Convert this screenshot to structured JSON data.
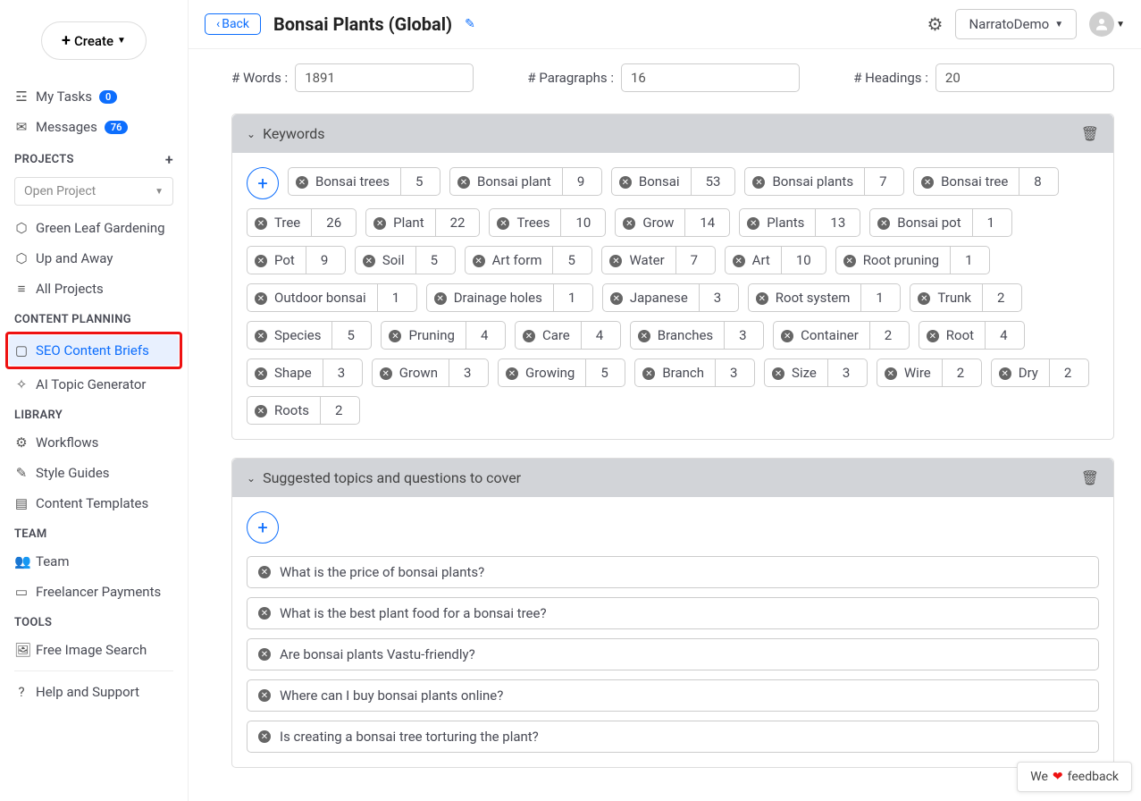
{
  "sidebar": {
    "create": "Create",
    "my_tasks": "My Tasks",
    "my_tasks_badge": "0",
    "messages": "Messages",
    "messages_badge": "76",
    "projects_head": "PROJECTS",
    "open_project": "Open Project",
    "projects": [
      "Green Leaf Gardening",
      "Up and Away",
      "All Projects"
    ],
    "content_planning_head": "CONTENT PLANNING",
    "seo_briefs": "SEO Content Briefs",
    "ai_topic": "AI Topic Generator",
    "library_head": "LIBRARY",
    "workflows": "Workflows",
    "style_guides": "Style Guides",
    "templates": "Content Templates",
    "team_head": "TEAM",
    "team": "Team",
    "freelancer": "Freelancer Payments",
    "tools_head": "TOOLS",
    "image_search": "Free Image Search",
    "help": "Help and Support"
  },
  "header": {
    "back": "Back",
    "title": "Bonsai Plants (Global)",
    "dropdown": "NarratoDemo"
  },
  "stats": {
    "words_label": "# Words :",
    "words": "1891",
    "paras_label": "# Paragraphs :",
    "paras": "16",
    "heads_label": "# Headings :",
    "heads": "20"
  },
  "keywords_title": "Keywords",
  "keywords": [
    {
      "label": "Bonsai trees",
      "count": "5"
    },
    {
      "label": "Bonsai plant",
      "count": "9"
    },
    {
      "label": "Bonsai",
      "count": "53"
    },
    {
      "label": "Bonsai plants",
      "count": "7"
    },
    {
      "label": "Bonsai tree",
      "count": "8"
    },
    {
      "label": "Tree",
      "count": "26"
    },
    {
      "label": "Plant",
      "count": "22"
    },
    {
      "label": "Trees",
      "count": "10"
    },
    {
      "label": "Grow",
      "count": "14"
    },
    {
      "label": "Plants",
      "count": "13"
    },
    {
      "label": "Bonsai pot",
      "count": "1"
    },
    {
      "label": "Pot",
      "count": "9"
    },
    {
      "label": "Soil",
      "count": "5"
    },
    {
      "label": "Art form",
      "count": "5"
    },
    {
      "label": "Water",
      "count": "7"
    },
    {
      "label": "Art",
      "count": "10"
    },
    {
      "label": "Root pruning",
      "count": "1"
    },
    {
      "label": "Outdoor bonsai",
      "count": "1"
    },
    {
      "label": "Drainage holes",
      "count": "1"
    },
    {
      "label": "Japanese",
      "count": "3"
    },
    {
      "label": "Root system",
      "count": "1"
    },
    {
      "label": "Trunk",
      "count": "2"
    },
    {
      "label": "Species",
      "count": "5"
    },
    {
      "label": "Pruning",
      "count": "4"
    },
    {
      "label": "Care",
      "count": "4"
    },
    {
      "label": "Branches",
      "count": "3"
    },
    {
      "label": "Container",
      "count": "2"
    },
    {
      "label": "Root",
      "count": "4"
    },
    {
      "label": "Shape",
      "count": "3"
    },
    {
      "label": "Grown",
      "count": "3"
    },
    {
      "label": "Growing",
      "count": "5"
    },
    {
      "label": "Branch",
      "count": "3"
    },
    {
      "label": "Size",
      "count": "3"
    },
    {
      "label": "Wire",
      "count": "2"
    },
    {
      "label": "Dry",
      "count": "2"
    },
    {
      "label": "Roots",
      "count": "2"
    }
  ],
  "topics_title": "Suggested topics and questions to cover",
  "topics": [
    "What is the price of bonsai plants?",
    "What is the best plant food for a bonsai tree?",
    "Are bonsai plants Vastu-friendly?",
    "Where can I buy bonsai plants online?",
    "Is creating a bonsai tree torturing the plant?"
  ],
  "feedback": {
    "pre": "We",
    "post": "feedback"
  }
}
